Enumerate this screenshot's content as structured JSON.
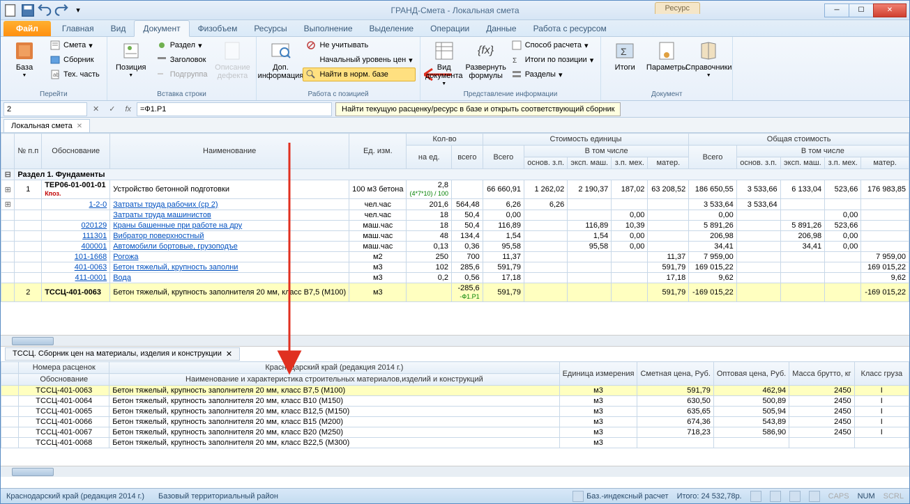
{
  "title": "ГРАНД-Смета - Локальная смета",
  "context_tab": "Ресурс",
  "tabs": {
    "file": "Файл",
    "main": "Главная",
    "view": "Вид",
    "doc": "Документ",
    "phys": "Физобъем",
    "res": "Ресурсы",
    "exec": "Выполнение",
    "sel": "Выделение",
    "ops": "Операции",
    "data": "Данные",
    "work": "Работа с ресурсом"
  },
  "groups": {
    "go": {
      "label": "Перейти",
      "base": "База",
      "smeta": "Смета",
      "sbornik": "Сборник",
      "tech": "Тех. часть"
    },
    "ins": {
      "label": "Вставка строки",
      "pos": "Позиция",
      "razdel": "Раздел",
      "zag": "Заголовок",
      "podgr": "Подгруппа",
      "defect": "Описание дефекта"
    },
    "pos": {
      "label": "Работа с позицией",
      "dop": "Доп. информация",
      "neuch": "Не учитывать",
      "nach": "Начальный уровень цен",
      "find": "Найти в норм. базе"
    },
    "pres": {
      "label": "Представление информации",
      "viddoc": "Вид документа",
      "razv": "Развернуть формулы",
      "sposob": "Способ расчета",
      "itogipos": "Итоги по позиции",
      "razdely": "Разделы"
    },
    "docg": {
      "label": "Документ",
      "itogi": "Итоги",
      "param": "Параметры",
      "sprav": "Справочники"
    }
  },
  "tooltip": "Найти текущую расценку/ресурс в базе и открыть соответствующий сборник",
  "formula": {
    "cell": "2",
    "value": "=Ф1.Р1"
  },
  "doctab": "Локальная смета",
  "headers": {
    "npp": "№ п.п",
    "obosn": "Обоснование",
    "naim": "Наименование",
    "ed": "Ед. изм.",
    "kolvo": "Кол-во",
    "naed": "на ед.",
    "vsego": "всего",
    "stoim": "Стоимость единицы",
    "vtom": "В том числе",
    "osn": "основ. з.п.",
    "eksp": "эксп. маш.",
    "zpmeh": "з.п. мех.",
    "mater": "матер.",
    "obsh": "Общая стоимость",
    "Vsego": "Всего"
  },
  "section": "Раздел 1. Фундаменты",
  "rows": [
    {
      "n": "1",
      "ob": "ТЕР06-01-001-01",
      "kpoz": "Кпоз.",
      "nm": "Устройство бетонной подготовки",
      "ed": "100 м3 бетона",
      "ned": "2,8",
      "f": "(4*7*10) / 100",
      "vs": "66 660,91",
      "c1": "1 262,02",
      "c2": "2 190,37",
      "c3": "187,02",
      "c4": "63 208,52",
      "t": "186 650,55",
      "t1": "3 533,66",
      "t2": "6 133,04",
      "t3": "523,66",
      "t4": "176 983,85"
    },
    {
      "ob": "1-2-0",
      "nm": "Затраты труда рабочих (ср 2)",
      "ed": "чел.час",
      "ned": "201,6",
      "vsk": "564,48",
      "vs": "6,26",
      "c1": "6,26",
      "t": "3 533,64",
      "t1": "3 533,64"
    },
    {
      "nm": "Затраты труда машинистов",
      "ed": "чел.час",
      "ned": "18",
      "vsk": "50,4",
      "vs": "0,00",
      "c3": "0,00",
      "t": "0,00",
      "t3": "0,00"
    },
    {
      "ob": "020129",
      "nm": "Краны башенные при работе на дру",
      "ed": "маш.час",
      "ned": "18",
      "vsk": "50,4",
      "vs": "116,89",
      "c2": "116,89",
      "c3": "10,39",
      "t": "5 891,26",
      "t2": "5 891,26",
      "t3": "523,66"
    },
    {
      "ob": "111301",
      "nm": "Вибратор поверхностный",
      "ed": "маш.час",
      "ned": "48",
      "vsk": "134,4",
      "vs": "1,54",
      "c2": "1,54",
      "c3": "0,00",
      "t": "206,98",
      "t2": "206,98",
      "t3": "0,00"
    },
    {
      "ob": "400001",
      "nm": "Автомобили бортовые, грузоподъе",
      "ed": "маш.час",
      "ned": "0,13",
      "vsk": "0,36",
      "vs": "95,58",
      "c2": "95,58",
      "c3": "0,00",
      "t": "34,41",
      "t2": "34,41",
      "t3": "0,00"
    },
    {
      "ob": "101-1668",
      "nm": "Рогожа",
      "ed": "м2",
      "ned": "250",
      "vsk": "700",
      "vs": "11,37",
      "c4": "11,37",
      "t": "7 959,00",
      "t4": "7 959,00"
    },
    {
      "ob": "401-0063",
      "nm": "Бетон тяжелый, крупность заполни",
      "ed": "м3",
      "ned": "102",
      "vsk": "285,6",
      "vs": "591,79",
      "c4": "591,79",
      "t": "169 015,22",
      "t4": "169 015,22"
    },
    {
      "ob": "411-0001",
      "nm": "Вода",
      "ed": "м3",
      "ned": "0,2",
      "vsk": "0,56",
      "vs": "17,18",
      "c4": "17,18",
      "t": "9,62",
      "t4": "9,62"
    }
  ],
  "selrow": {
    "n": "2",
    "ob": "ТССЦ-401-0063",
    "nm": "Бетон тяжелый, крупность заполнителя 20 мм, класс В7,5 (М100)",
    "ed": "м3",
    "vsk": "-285,6",
    "f": "-Ф1.Р1",
    "vs": "591,79",
    "c4": "591,79",
    "t": "-169 015,22",
    "t4": "-169 015,22"
  },
  "lowertab": "ТССЦ. Сборник цен на материалы, изделия и конструкции",
  "lowerheaders": {
    "nomr": "Номера расценок",
    "obosn": "Обоснование",
    "naimkh": "Наименование и характеристика строительных материалов,изделий и конструкций",
    "region": "Краснодарский край (редакция 2014 г.)",
    "ed": "Единица измерения",
    "smet": "Сметная цена, Руб.",
    "opt": "Оптовая цена, Руб.",
    "massa": "Масса брутто, кг",
    "klass": "Класс груза"
  },
  "lowerrows": [
    {
      "ob": "ТССЦ-401-0063",
      "nm": "Бетон тяжелый, крупность заполнителя 20 мм, класс В7,5 (М100)",
      "ed": "м3",
      "s": "591,79",
      "o": "462,94",
      "m": "2450",
      "k": "I",
      "sel": true
    },
    {
      "ob": "ТССЦ-401-0064",
      "nm": "Бетон тяжелый, крупность заполнителя 20 мм, класс В10 (М150)",
      "ed": "м3",
      "s": "630,50",
      "o": "500,89",
      "m": "2450",
      "k": "I"
    },
    {
      "ob": "ТССЦ-401-0065",
      "nm": "Бетон тяжелый, крупность заполнителя 20 мм, класс В12,5 (М150)",
      "ed": "м3",
      "s": "635,65",
      "o": "505,94",
      "m": "2450",
      "k": "I"
    },
    {
      "ob": "ТССЦ-401-0066",
      "nm": "Бетон тяжелый, крупность заполнителя 20 мм, класс В15 (М200)",
      "ed": "м3",
      "s": "674,36",
      "o": "543,89",
      "m": "2450",
      "k": "I"
    },
    {
      "ob": "ТССЦ-401-0067",
      "nm": "Бетон тяжелый, крупность заполнителя 20 мм, класс В20 (М250)",
      "ed": "м3",
      "s": "718,23",
      "o": "586,90",
      "m": "2450",
      "k": "I"
    },
    {
      "ob": "ТССЦ-401-0068",
      "nm": "Бетон тяжелый, крупность заполнителя 20 мм, класс В22,5 (М300)",
      "ed": "м3",
      "s": "",
      "o": "",
      "m": "",
      "k": ""
    }
  ],
  "status": {
    "region": "Краснодарский край (редакция 2014 г.)",
    "terr": "Базовый территориальный район",
    "calc": "Баз.-индексный расчет",
    "itogo": "Итого: 24 532,78р.",
    "caps": "CAPS",
    "num": "NUM",
    "scrl": "SCRL"
  }
}
